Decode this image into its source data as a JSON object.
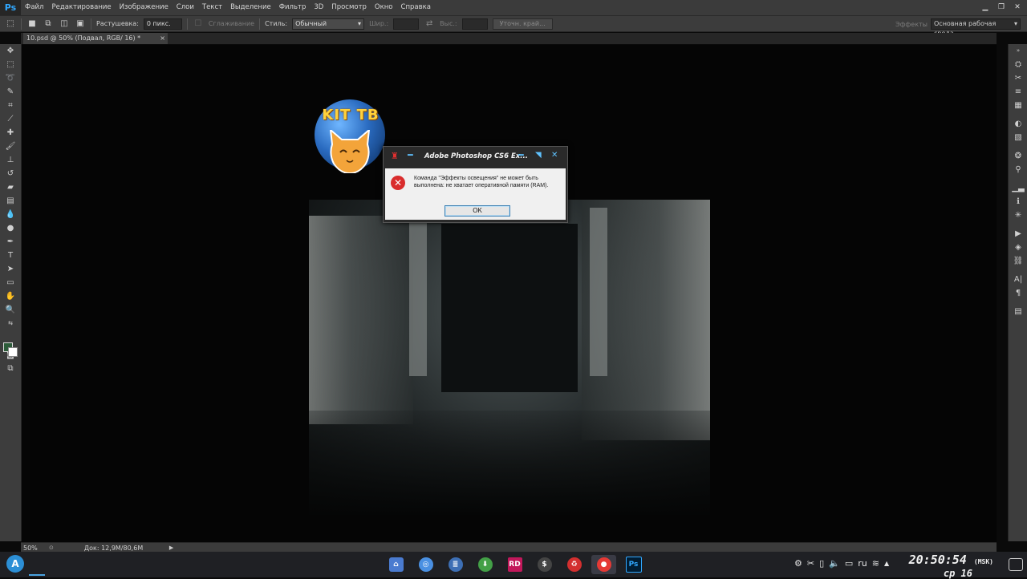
{
  "app": {
    "logo": "Ps"
  },
  "menu": [
    "Файл",
    "Редактирование",
    "Изображение",
    "Слои",
    "Текст",
    "Выделение",
    "Фильтр",
    "3D",
    "Просмотр",
    "Окно",
    "Справка"
  ],
  "options": {
    "feather_label": "Растушевка:",
    "feather_value": "0 пикс.",
    "antialias_label": "Сглаживание",
    "style_label": "Стиль:",
    "style_value": "Обычный",
    "width_label": "Шир.:",
    "height_label": "Выс.:",
    "refine_button": "Уточн. край...",
    "effects_label": "Эффекты",
    "workspace_value": "Основная рабочая среда"
  },
  "document": {
    "tab_title": "10.psd @ 50% (Подвал, RGB/ 16) *"
  },
  "logo_overlay": {
    "text": "KIT TB"
  },
  "status": {
    "zoom": "50%",
    "doc": "Док: 12,9M/80,6M"
  },
  "dialog": {
    "title": "Adobe Photoshop CS6 Ex...",
    "message": "Команда \"Эффекты освещения\" не может быть выполнена: не хватает оперативной памяти (RAM).",
    "ok": "OK"
  },
  "taskbar": {
    "lang": "ru",
    "time": "20:50:54",
    "tz": "(MSK)",
    "date": "ср 16",
    "apps": [
      "files",
      "browser",
      "document",
      "download",
      "rider",
      "terminal",
      "recycle",
      "game",
      "photoshop"
    ]
  },
  "colors": {
    "foreground": "#2d5c3a",
    "background": "#ffffff",
    "accent": "#31a8ff"
  }
}
